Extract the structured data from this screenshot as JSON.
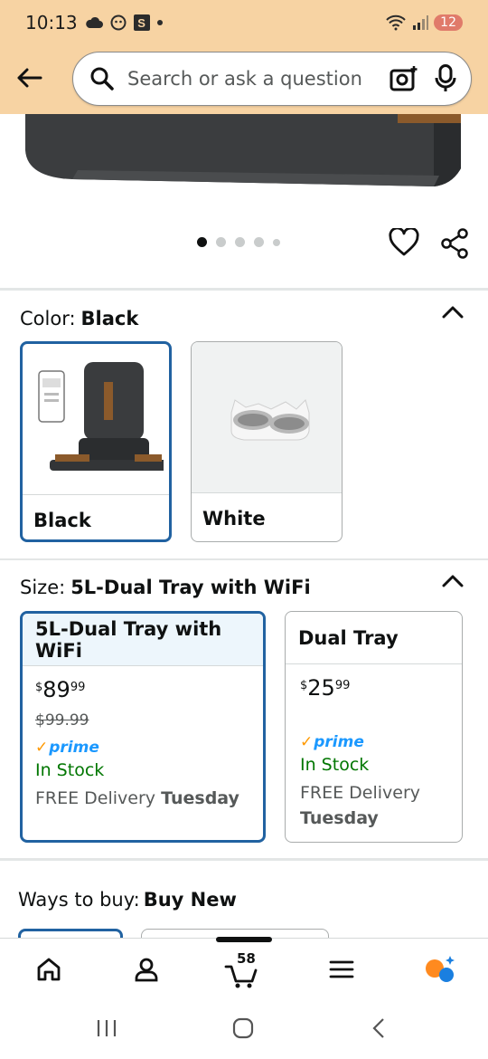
{
  "status_bar": {
    "time": "10:13",
    "sim_letter": "S",
    "battery": "12"
  },
  "search": {
    "placeholder": "Search or ask a question"
  },
  "carousel": {
    "dot_count": 5,
    "active_index": 0
  },
  "color_section": {
    "label": "Color:",
    "selected": "Black",
    "options": [
      {
        "name": "Black",
        "selected": true
      },
      {
        "name": "White",
        "selected": false
      }
    ]
  },
  "size_section": {
    "label": "Size:",
    "selected": "5L-Dual Tray with WiFi",
    "options": [
      {
        "name": "5L-Dual Tray with WiFi",
        "selected": true,
        "price_symbol": "$",
        "price_whole": "89",
        "price_cents": "99",
        "list_price": "$99.99",
        "prime": "prime",
        "stock": "In Stock",
        "delivery_prefix": "FREE Delivery",
        "delivery_day": "Tuesday"
      },
      {
        "name": "Dual Tray",
        "selected": false,
        "price_symbol": "$",
        "price_whole": "25",
        "price_cents": "99",
        "prime": "prime",
        "stock": "In Stock",
        "delivery_prefix": "FREE Delivery",
        "delivery_day": "Tuesday"
      }
    ]
  },
  "ways_to_buy": {
    "label": "Ways to buy:",
    "value": "Buy New"
  },
  "bottom_nav": {
    "cart_count": "58"
  },
  "colors": {
    "header_bg": "#f7d3a3",
    "selected_border": "#2162a1",
    "in_stock": "#007600",
    "prime_blue": "#1a98ff",
    "prime_check": "#ff9900"
  }
}
